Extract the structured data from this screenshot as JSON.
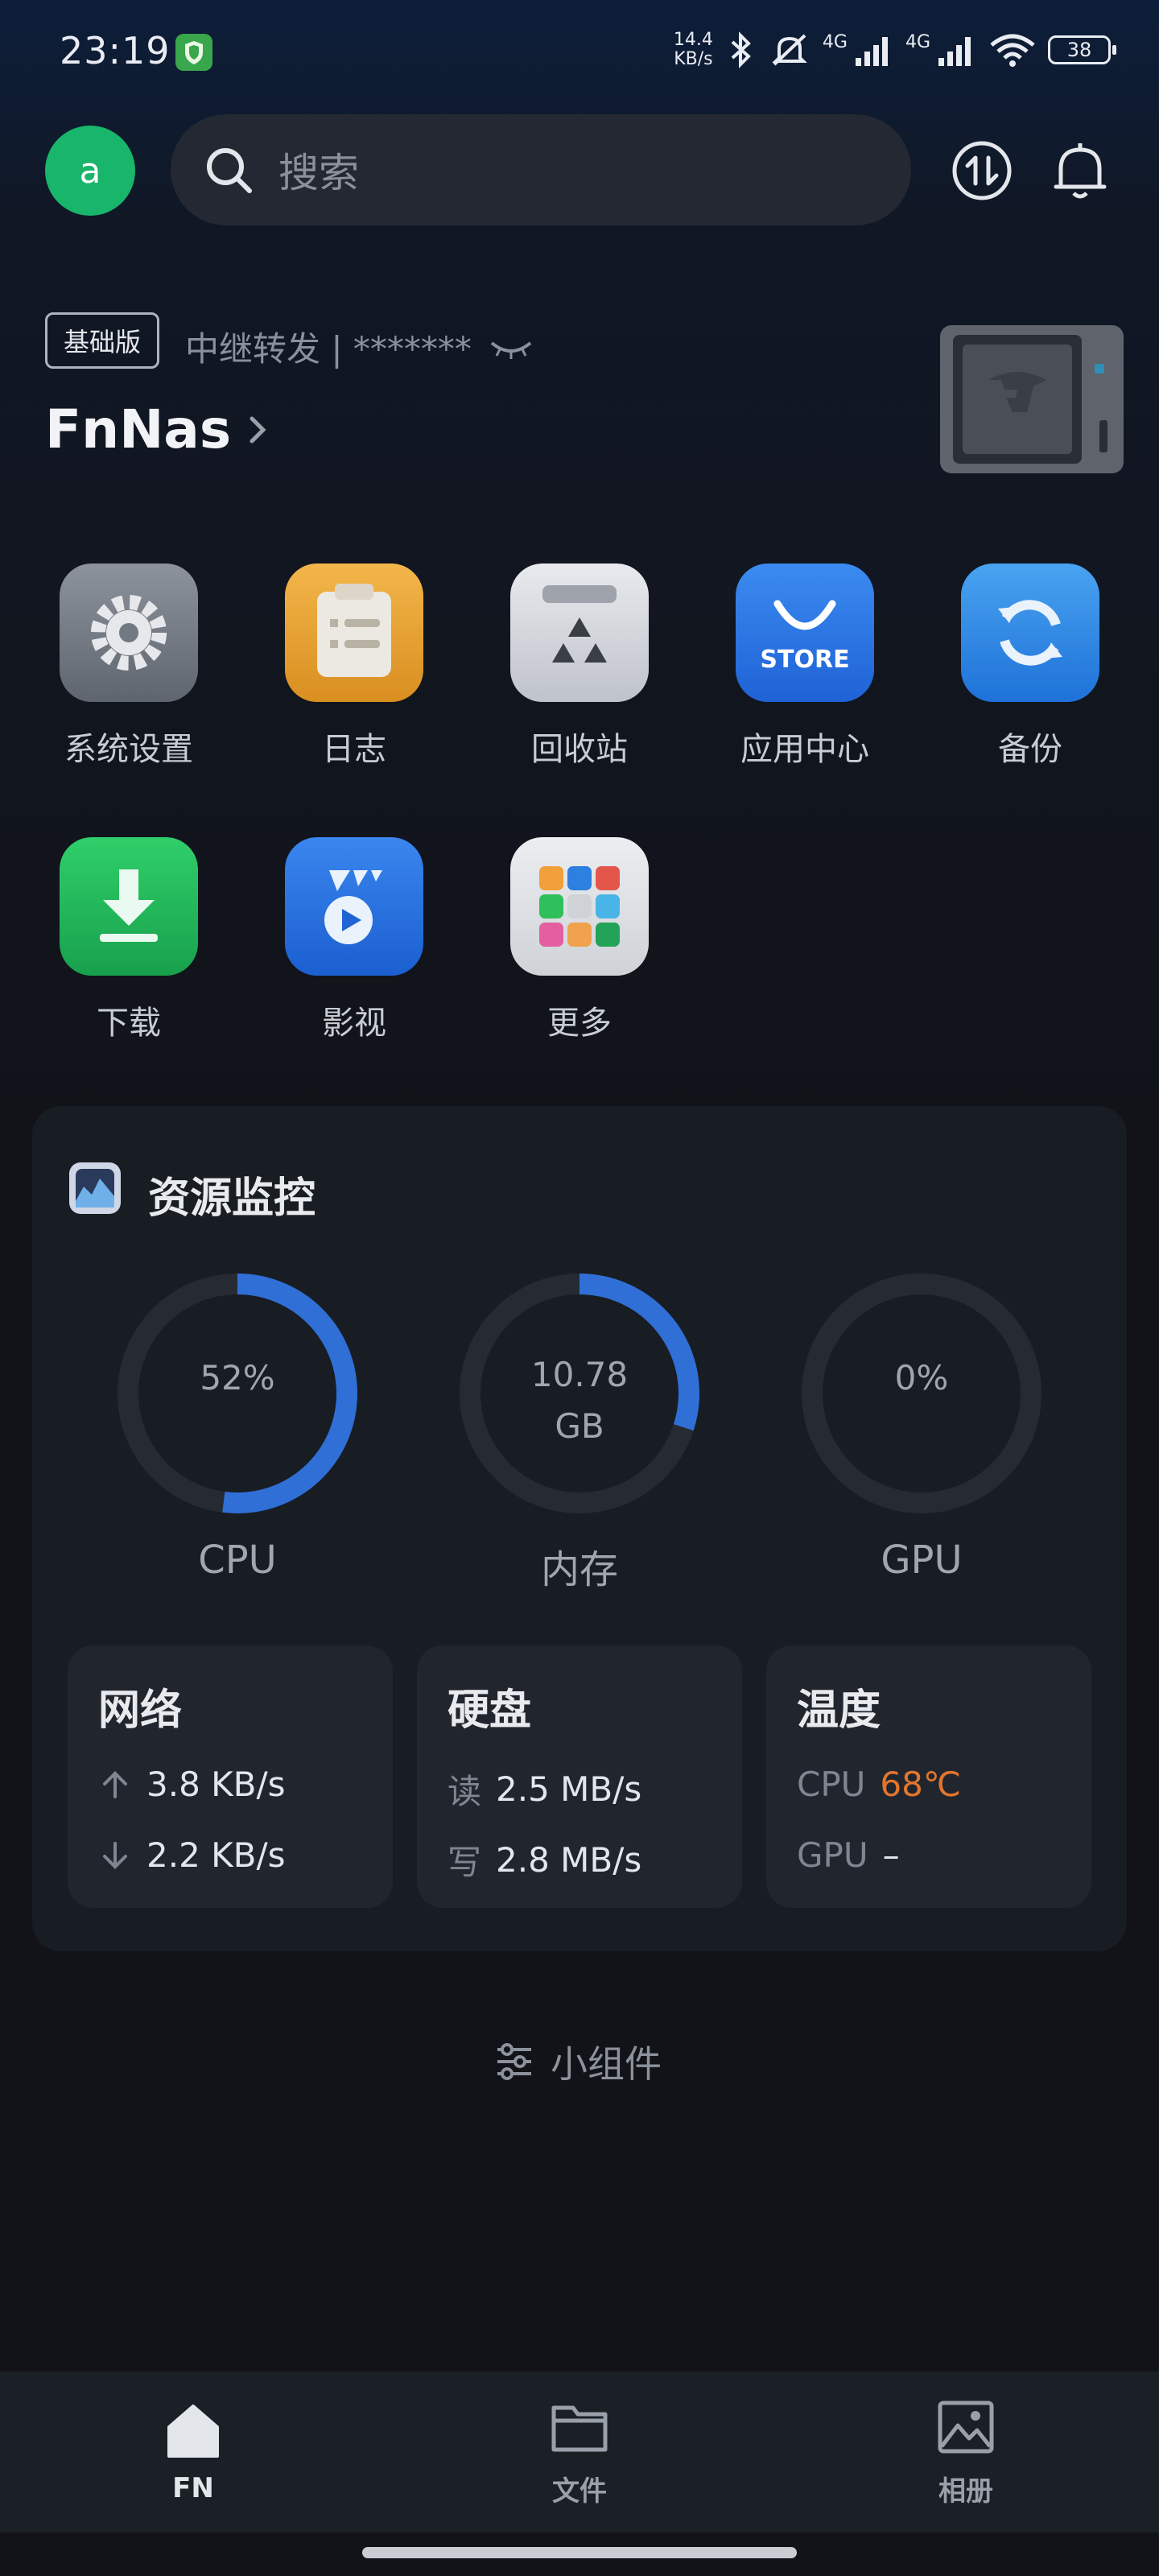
{
  "status_bar": {
    "time": "23:19",
    "net_speed_value": "14.4",
    "net_speed_unit": "KB/s",
    "signal_1": "4G",
    "signal_2": "4G",
    "battery": "38",
    "icons": [
      "app-shield-icon",
      "bluetooth-icon",
      "mute-icon",
      "signal-icon",
      "wifi-icon",
      "battery-icon"
    ]
  },
  "header": {
    "avatar_letter": "a",
    "search_placeholder": "搜索",
    "icons": [
      "search-icon",
      "transfer-icon",
      "bell-icon"
    ]
  },
  "device": {
    "tier": "基础版",
    "relay_text": "中继转发 | *******",
    "name": "FnNas"
  },
  "apps": [
    {
      "label": "系统设置",
      "icon": "settings-icon"
    },
    {
      "label": "日志",
      "icon": "log-icon"
    },
    {
      "label": "回收站",
      "icon": "recycle-icon"
    },
    {
      "label": "应用中心",
      "icon": "store-icon",
      "badge_text": "STORE"
    },
    {
      "label": "备份",
      "icon": "backup-icon"
    },
    {
      "label": "下载",
      "icon": "download-icon"
    },
    {
      "label": "影视",
      "icon": "video-icon"
    },
    {
      "label": "更多",
      "icon": "more-icon"
    }
  ],
  "monitor": {
    "title": "资源监控",
    "gauges": [
      {
        "label": "CPU",
        "text_line1": "52%",
        "text_line2": "",
        "fraction": 0.52
      },
      {
        "label": "内存",
        "text_line1": "10.78",
        "text_line2": "GB",
        "fraction": 0.3
      },
      {
        "label": "GPU",
        "text_line1": "0%",
        "text_line2": "",
        "fraction": 0.0
      }
    ],
    "network": {
      "title": "网络",
      "up": "3.8 KB/s",
      "down": "2.2 KB/s"
    },
    "disk": {
      "title": "硬盘",
      "read_key": "读",
      "read": "2.5 MB/s",
      "write_key": "写",
      "write": "2.8 MB/s"
    },
    "temperature": {
      "title": "温度",
      "cpu_key": "CPU",
      "cpu": "68℃",
      "gpu_key": "GPU",
      "gpu": "–"
    }
  },
  "widgets_label": "小组件",
  "colors": {
    "gauge_fill": "#2f6fd6",
    "gauge_track": "#262b33",
    "accent_hot": "#e5752b",
    "avatar": "#18b56a"
  },
  "bottom_nav": [
    {
      "label": "FN",
      "icon": "home-icon",
      "active": true
    },
    {
      "label": "文件",
      "icon": "folder-icon",
      "active": false
    },
    {
      "label": "相册",
      "icon": "photo-icon",
      "active": false
    }
  ]
}
